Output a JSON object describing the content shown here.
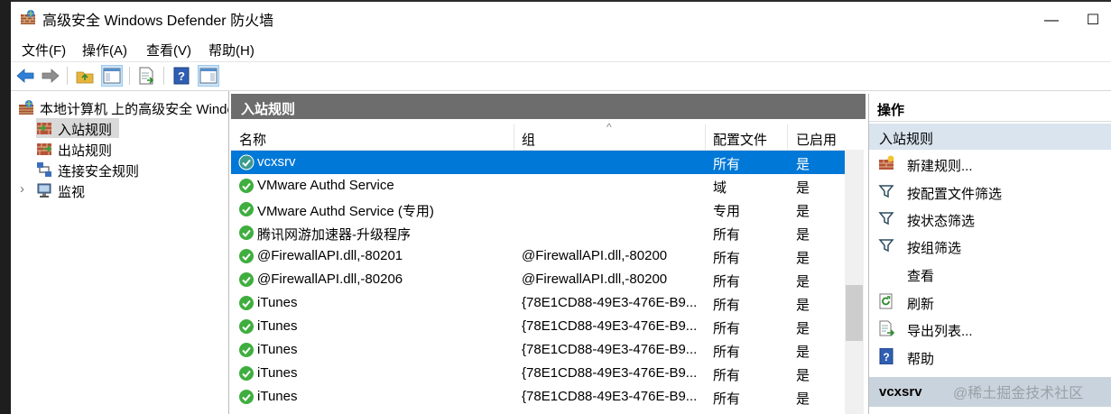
{
  "window": {
    "title": "高级安全 Windows Defender 防火墙",
    "minimize": "—",
    "maximize": "☐"
  },
  "menu": [
    "文件(F)",
    "操作(A)",
    "查看(V)",
    "帮助(H)"
  ],
  "tree": {
    "root": "本地计算机 上的高级安全 Windows Defender 防火墙",
    "items": [
      "入站规则",
      "出站规则",
      "连接安全规则",
      "监视"
    ],
    "expander": "›"
  },
  "center": {
    "title": "入站规则",
    "sort_indicator": "^",
    "columns": [
      "名称",
      "组",
      "配置文件",
      "已启用"
    ],
    "rows": [
      {
        "name": "vcxsrv",
        "group": "",
        "profile": "所有",
        "enabled": "是"
      },
      {
        "name": "VMware Authd Service",
        "group": "",
        "profile": "域",
        "enabled": "是"
      },
      {
        "name": "VMware Authd Service (专用)",
        "group": "",
        "profile": "专用",
        "enabled": "是"
      },
      {
        "name": "腾讯网游加速器-升级程序",
        "group": "",
        "profile": "所有",
        "enabled": "是"
      },
      {
        "name": "@FirewallAPI.dll,-80201",
        "group": "@FirewallAPI.dll,-80200",
        "profile": "所有",
        "enabled": "是"
      },
      {
        "name": "@FirewallAPI.dll,-80206",
        "group": "@FirewallAPI.dll,-80200",
        "profile": "所有",
        "enabled": "是"
      },
      {
        "name": "iTunes",
        "group": "{78E1CD88-49E3-476E-B9...",
        "profile": "所有",
        "enabled": "是"
      },
      {
        "name": "iTunes",
        "group": "{78E1CD88-49E3-476E-B9...",
        "profile": "所有",
        "enabled": "是"
      },
      {
        "name": "iTunes",
        "group": "{78E1CD88-49E3-476E-B9...",
        "profile": "所有",
        "enabled": "是"
      },
      {
        "name": "iTunes",
        "group": "{78E1CD88-49E3-476E-B9...",
        "profile": "所有",
        "enabled": "是"
      },
      {
        "name": "iTunes",
        "group": "{78E1CD88-49E3-476E-B9...",
        "profile": "所有",
        "enabled": "是"
      }
    ]
  },
  "actions": {
    "title": "操作",
    "section": "入站规则",
    "items": [
      "新建规则...",
      "按配置文件筛选",
      "按状态筛选",
      "按组筛选",
      "查看",
      "刷新",
      "导出列表...",
      "帮助"
    ],
    "section2": "vcxsrv"
  },
  "watermark": "@稀土掘金技术社区",
  "colors": {
    "selection": "#0078d7",
    "header": "#6d6d6d",
    "section": "#d9e4ee"
  }
}
